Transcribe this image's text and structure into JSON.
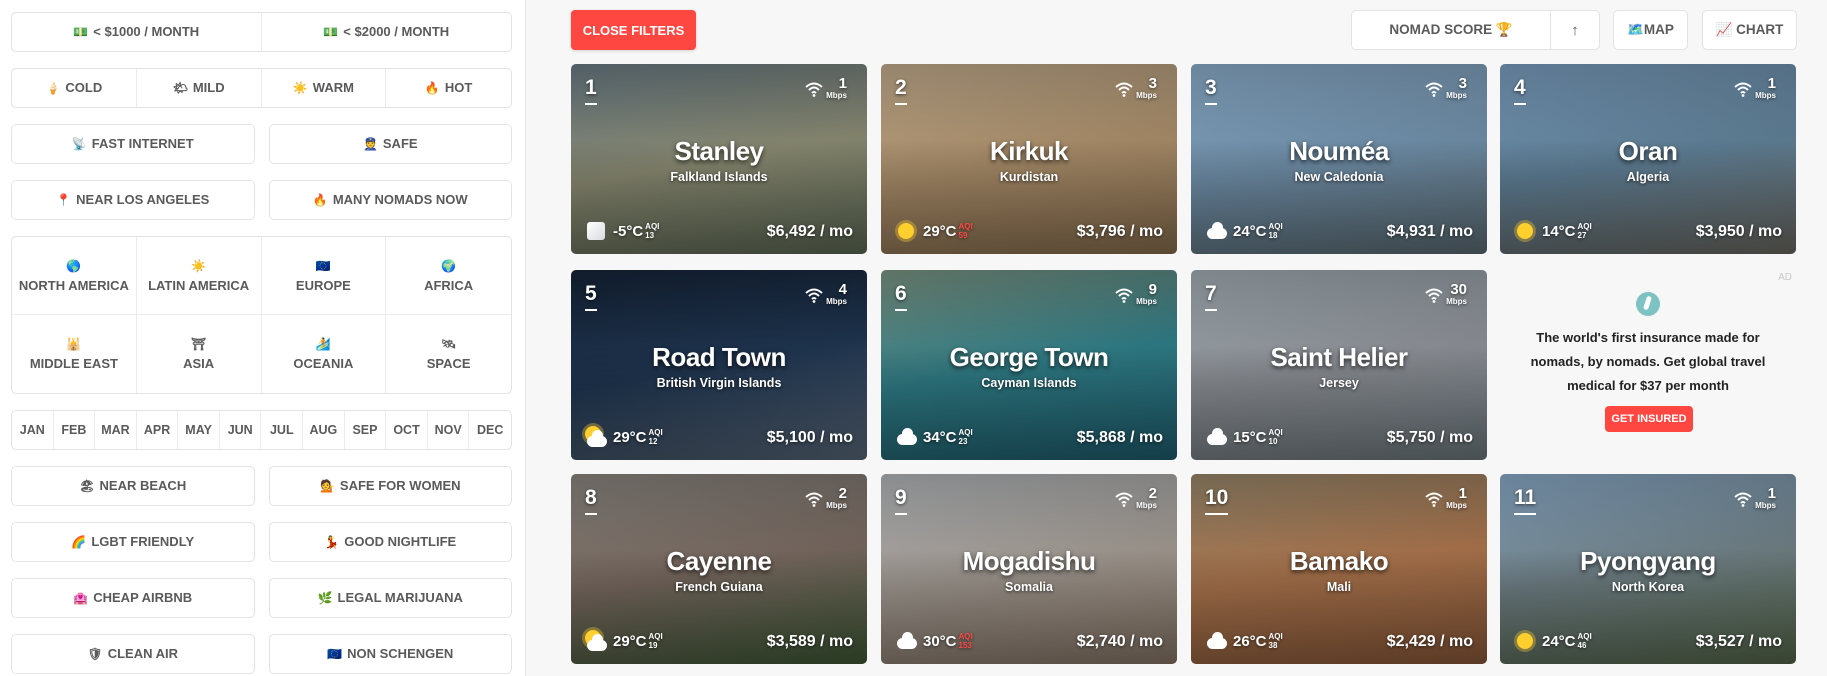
{
  "filters": {
    "budget": [
      {
        "icon": "💵",
        "label": "< $1000 / MONTH"
      },
      {
        "icon": "💵",
        "label": "< $2000 / MONTH"
      }
    ],
    "climate": [
      {
        "icon": "🍦",
        "label": "COLD"
      },
      {
        "icon": "🌤",
        "label": "MILD"
      },
      {
        "icon": "☀️",
        "label": "WARM"
      },
      {
        "icon": "🔥",
        "label": "HOT"
      }
    ],
    "row3": [
      {
        "icon": "📡",
        "label": "FAST INTERNET"
      },
      {
        "icon": "👮",
        "label": "SAFE"
      }
    ],
    "row4": [
      {
        "icon": "📍",
        "label": "NEAR LOS ANGELES"
      },
      {
        "icon": "🔥",
        "label": "MANY NOMADS NOW"
      }
    ],
    "regions": [
      {
        "icon": "🌎",
        "label": "NORTH AMERICA"
      },
      {
        "icon": "☀️",
        "label": "LATIN AMERICA"
      },
      {
        "icon": "🇪🇺",
        "label": "EUROPE"
      },
      {
        "icon": "🌍",
        "label": "AFRICA"
      },
      {
        "icon": "🕌",
        "label": "MIDDLE EAST"
      },
      {
        "icon": "⛩",
        "label": "ASIA"
      },
      {
        "icon": "🏄",
        "label": "OCEANIA"
      },
      {
        "icon": "🛰",
        "label": "SPACE"
      }
    ],
    "months": [
      "JAN",
      "FEB",
      "MAR",
      "APR",
      "MAY",
      "JUN",
      "JUL",
      "AUG",
      "SEP",
      "OCT",
      "NOV",
      "DEC"
    ],
    "row7": [
      {
        "icon": "🏖",
        "label": "NEAR BEACH"
      },
      {
        "icon": "💁",
        "label": "SAFE FOR WOMEN"
      }
    ],
    "row8": [
      {
        "icon": "🌈",
        "label": "LGBT FRIENDLY"
      },
      {
        "icon": "💃",
        "label": "GOOD NIGHTLIFE"
      }
    ],
    "row9": [
      {
        "icon": "🏩",
        "label": "CHEAP AIRBNB"
      },
      {
        "icon": "🌿",
        "label": "LEGAL MARIJUANA"
      }
    ],
    "row10": [
      {
        "icon": "🛡",
        "label": "CLEAN AIR"
      },
      {
        "icon": "🇪🇺",
        "label": "NON SCHENGEN"
      }
    ]
  },
  "toolbar": {
    "close_filters": "CLOSE FILTERS",
    "sort_label": "NOMAD SCORE 🏆",
    "sort_dir": "↑",
    "map_label": "🗺️MAP",
    "chart_label": "📈 CHART"
  },
  "accent_color": "#ff4742",
  "cities": [
    {
      "rank": "1",
      "name": "Stanley",
      "country": "Falkland Islands",
      "speed": "1",
      "speed_unit": "Mbps",
      "weather": "snow",
      "temp": "-5°C",
      "aqi_label": "AQI",
      "aqi": "13",
      "aqi_bad": false,
      "cost": "$6,492 / mo",
      "bg": [
        "#6d7f88",
        "#8a8a72",
        "#5d6a55"
      ]
    },
    {
      "rank": "2",
      "name": "Kirkuk",
      "country": "Kurdistan",
      "speed": "3",
      "speed_unit": "Mbps",
      "weather": "sun",
      "temp": "29°C",
      "aqi_label": "AQI",
      "aqi": "59",
      "aqi_bad": true,
      "cost": "$3,796 / mo",
      "bg": [
        "#c9b292",
        "#a88c69",
        "#8a6f4f"
      ]
    },
    {
      "rank": "3",
      "name": "Nouméa",
      "country": "New Caledonia",
      "speed": "3",
      "speed_unit": "Mbps",
      "weather": "cloud",
      "temp": "24°C",
      "aqi_label": "AQI",
      "aqi": "18",
      "aqi_bad": false,
      "cost": "$4,931 / mo",
      "bg": [
        "#8fb2d1",
        "#6f8ea8",
        "#5d6d74"
      ]
    },
    {
      "rank": "4",
      "name": "Oran",
      "country": "Algeria",
      "speed": "1",
      "speed_unit": "Mbps",
      "weather": "sun",
      "temp": "14°C",
      "aqi_label": "AQI",
      "aqi": "27",
      "aqi_bad": false,
      "cost": "$3,950 / mo",
      "bg": [
        "#7fa4c6",
        "#5f7f96",
        "#6c6a62"
      ]
    },
    {
      "rank": "5",
      "name": "Road Town",
      "country": "British Virgin Islands",
      "speed": "4",
      "speed_unit": "Mbps",
      "weather": "sun-cloud",
      "temp": "29°C",
      "aqi_label": "AQI",
      "aqi": "12",
      "aqi_bad": false,
      "cost": "$5,100 / mo",
      "bg": [
        "#16253a",
        "#1f3550",
        "#5a6a7c"
      ]
    },
    {
      "rank": "6",
      "name": "George Town",
      "country": "Cayman Islands",
      "speed": "9",
      "speed_unit": "Mbps",
      "weather": "cloud",
      "temp": "34°C",
      "aqi_label": "AQI",
      "aqi": "23",
      "aqi_bad": false,
      "cost": "$5,868 / mo",
      "bg": [
        "#7f9a88",
        "#2f7c86",
        "#1f5f6f"
      ]
    },
    {
      "rank": "7",
      "name": "Saint Helier",
      "country": "Jersey",
      "speed": "30",
      "speed_unit": "Mbps",
      "weather": "cloud",
      "temp": "15°C",
      "aqi_label": "AQI",
      "aqi": "10",
      "aqi_bad": false,
      "cost": "$5,750 / mo",
      "bg": [
        "#a8b4bb",
        "#8c9096",
        "#6f7a80"
      ]
    },
    {
      "rank": "8",
      "name": "Cayenne",
      "country": "French Guiana",
      "speed": "2",
      "speed_unit": "Mbps",
      "weather": "sun-cloud",
      "temp": "29°C",
      "aqi_label": "AQI",
      "aqi": "19",
      "aqi_bad": false,
      "cost": "$3,589 / mo",
      "bg": [
        "#8f8a84",
        "#77685f",
        "#3f5a36"
      ]
    },
    {
      "rank": "9",
      "name": "Mogadishu",
      "country": "Somalia",
      "speed": "2",
      "speed_unit": "Mbps",
      "weather": "cloud",
      "temp": "30°C",
      "aqi_label": "AQI",
      "aqi": "153",
      "aqi_bad": true,
      "cost": "$2,740 / mo",
      "bg": [
        "#b8bcc0",
        "#a09890",
        "#8a7868"
      ]
    },
    {
      "rank": "10",
      "name": "Bamako",
      "country": "Mali",
      "speed": "1",
      "speed_unit": "Mbps",
      "weather": "cloud",
      "temp": "26°C",
      "aqi_label": "AQI",
      "aqi": "38",
      "aqi_bad": false,
      "cost": "$2,429 / mo",
      "bg": [
        "#9d8b6e",
        "#a9734c",
        "#8c5a3a"
      ]
    },
    {
      "rank": "11",
      "name": "Pyongyang",
      "country": "North Korea",
      "speed": "1",
      "speed_unit": "Mbps",
      "weather": "sun",
      "temp": "24°C",
      "aqi_label": "AQI",
      "aqi": "46",
      "aqi_bad": false,
      "cost": "$3,527 / mo",
      "bg": [
        "#8fb0cf",
        "#6f7f84",
        "#56684a"
      ]
    }
  ],
  "ad": {
    "label": "AD",
    "text": "The world's first insurance made for nomads, by nomads. Get global travel medical for $37 per month",
    "cta": "GET INSURED"
  }
}
